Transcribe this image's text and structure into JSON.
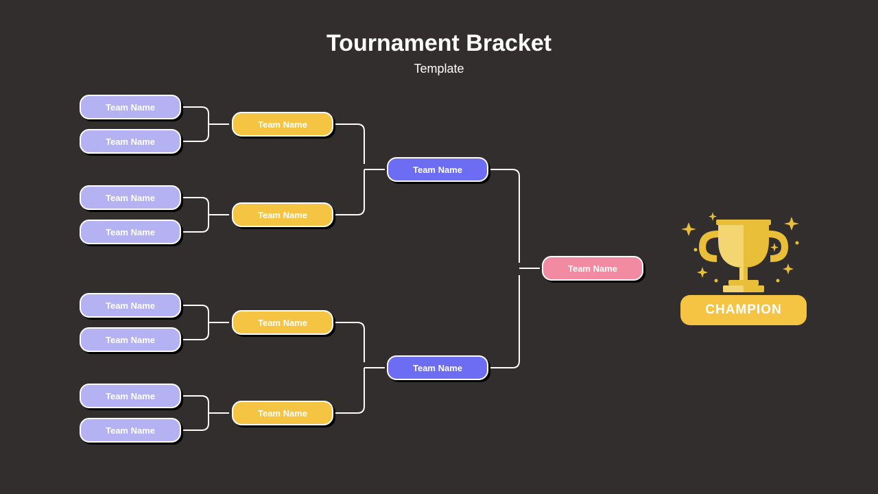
{
  "title": "Tournament Bracket",
  "subtitle": "Template",
  "champion_label": "CHAMPION",
  "rounds": {
    "r1": [
      {
        "label": "Team Name"
      },
      {
        "label": "Team Name"
      },
      {
        "label": "Team Name"
      },
      {
        "label": "Team Name"
      },
      {
        "label": "Team Name"
      },
      {
        "label": "Team Name"
      },
      {
        "label": "Team Name"
      },
      {
        "label": "Team Name"
      }
    ],
    "r2": [
      {
        "label": "Team Name"
      },
      {
        "label": "Team Name"
      },
      {
        "label": "Team Name"
      },
      {
        "label": "Team Name"
      }
    ],
    "r3": [
      {
        "label": "Team Name"
      },
      {
        "label": "Team Name"
      }
    ],
    "final": {
      "label": "Team Name"
    }
  },
  "colors": {
    "bg": "#332e2e",
    "r1": "#b4b2f3",
    "r2": "#f6c443",
    "r3": "#6d6df3",
    "final": "#f28aa1",
    "connector": "#ffffff",
    "trophy": "#e9bf3a",
    "trophy_light": "#f3d571"
  }
}
